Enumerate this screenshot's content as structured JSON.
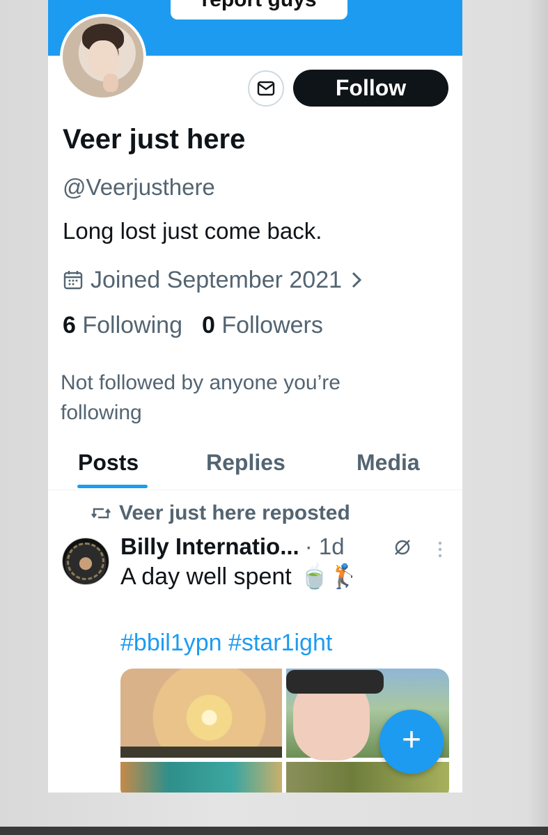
{
  "banner": {
    "caption": "report guys"
  },
  "profile": {
    "follow_label": "Follow",
    "name": "Veer just here",
    "handle": "@Veerjusthere",
    "bio": "Long lost just come back.",
    "joined": "Joined September 2021",
    "following_count": "6",
    "following_label": "Following",
    "followers_count": "0",
    "followers_label": "Followers",
    "not_followed_text": "Not followed by anyone you’re following"
  },
  "tabs": [
    {
      "label": "Posts",
      "active": true
    },
    {
      "label": "Replies",
      "active": false
    },
    {
      "label": "Media",
      "active": false
    }
  ],
  "post": {
    "repost_text": "Veer just here reposted",
    "author": "Billy Internatio...",
    "time": "· 1d",
    "text": "A day well spent",
    "emojis": "🍵🏌",
    "hashtags": "#bbil1ypn #star1ight"
  },
  "fab": {
    "label": "+"
  },
  "colors": {
    "accent": "#1d9bf0",
    "primary_text": "#0f1419",
    "secondary_text": "#536471",
    "follow_button_bg": "#0f1419"
  },
  "icons": {
    "message": "envelope-icon",
    "calendar": "calendar-icon",
    "chevron": "chevron-right-icon",
    "repost": "repost-icon",
    "grok": "grok-icon",
    "more": "more-vertical-icon"
  }
}
